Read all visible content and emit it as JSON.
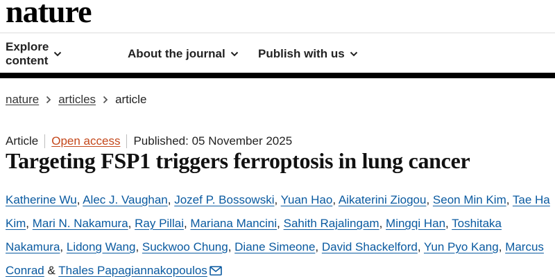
{
  "brand": {
    "logo": "nature"
  },
  "nav": {
    "items": [
      {
        "label": "Explore content"
      },
      {
        "label": "About the journal"
      },
      {
        "label": "Publish with us"
      }
    ]
  },
  "breadcrumb": {
    "items": [
      "nature",
      "articles",
      "article"
    ]
  },
  "article": {
    "type": "Article",
    "access": "Open access",
    "published": "Published: 05 November 2025",
    "title": "Targeting FSP1 triggers ferroptosis in lung cancer",
    "authors": [
      "Katherine Wu",
      "Alec J. Vaughan",
      "Jozef P. Bossowski",
      "Yuan Hao",
      "Aikaterini Ziogou",
      "Seon Min Kim",
      "Tae Ha Kim",
      "Mari N. Nakamura",
      "Ray Pillai",
      "Mariana Mancini",
      "Sahith Rajalingam",
      "Mingqi Han",
      "Toshitaka Nakamura",
      "Lidong Wang",
      "Suckwoo Chung",
      "Diane Simeone",
      "David Shackelford",
      "Yun Pyo Kang",
      "Marcus Conrad",
      "Thales Papagiannakopoulos"
    ],
    "author_separator": ", ",
    "last_author_separator": " & "
  },
  "colors": {
    "link": "#0a5aa0",
    "open_access": "#c4471a",
    "text": "#222222"
  },
  "icons": {
    "nav_dropdown": "chevron-down-icon",
    "breadcrumb_separator": "chevron-right-icon",
    "corresponding_author": "mail-icon"
  }
}
